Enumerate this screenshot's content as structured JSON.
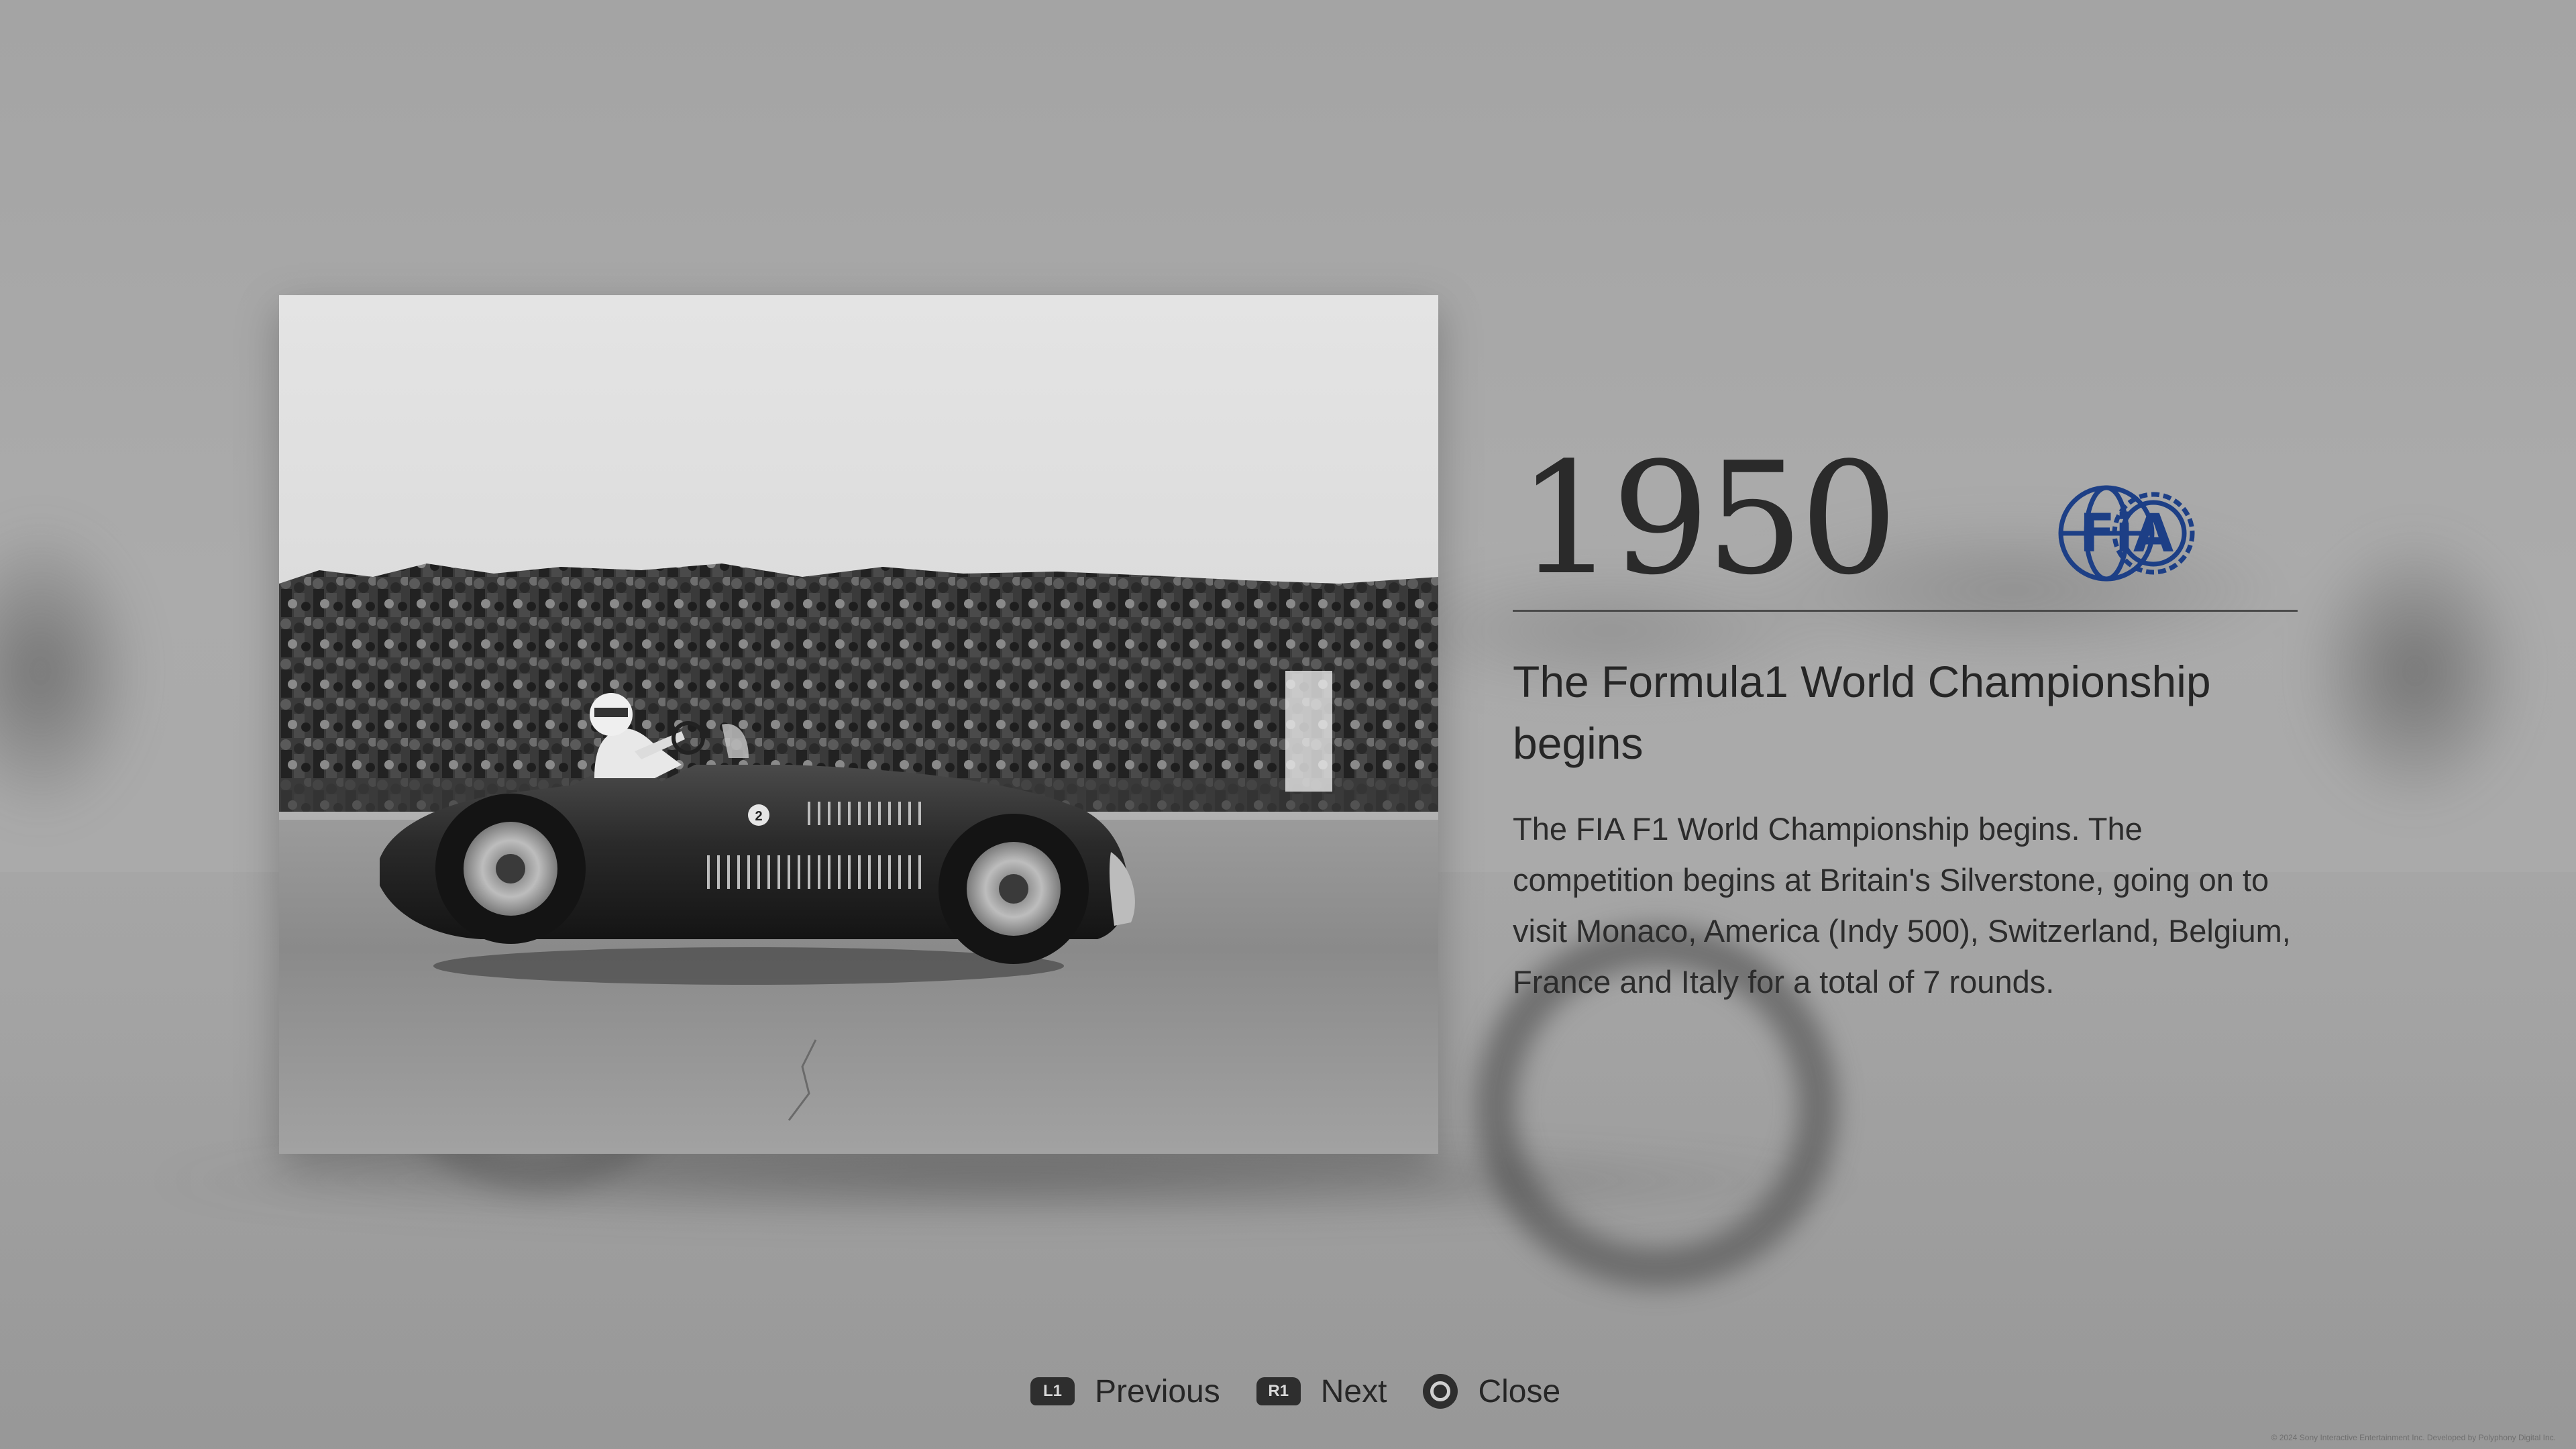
{
  "entry": {
    "year": "1950",
    "title": "The Formula1 World Championship begins",
    "description": "The FIA F1 World Championship begins. The competition begins at Britain's Silverstone, going on to visit Monaco, America (Indy 500), Switzerland, Belgium, France and Italy for a total of 7 rounds.",
    "logo_text": "FiA",
    "car_number": "2"
  },
  "controls": {
    "previous": {
      "button": "L1",
      "label": "Previous"
    },
    "next": {
      "button": "R1",
      "label": "Next"
    },
    "close": {
      "icon": "circle-button-icon",
      "label": "Close"
    }
  },
  "footer": {
    "copyright": "© 2024 Sony Interactive Entertainment Inc. Developed by Polyphony Digital Inc."
  },
  "colors": {
    "fia_blue": "#1d3f86",
    "background": "#a8a8a8",
    "text": "#262626"
  }
}
